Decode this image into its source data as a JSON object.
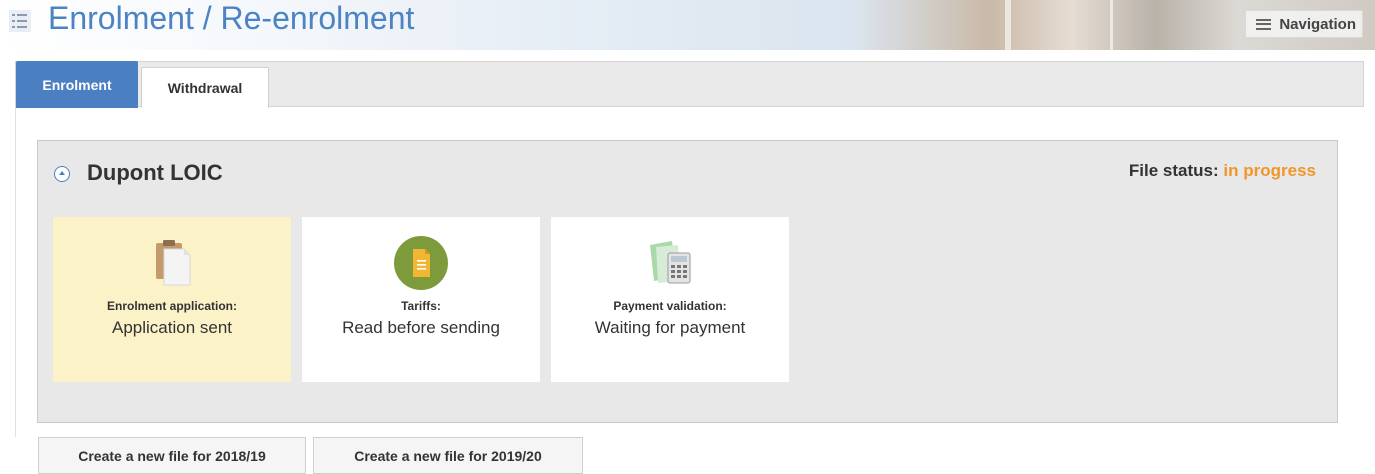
{
  "header": {
    "title": "Enrolment / Re-enrolment",
    "nav_label": "Navigation",
    "icon": "list-checklist-icon"
  },
  "tabs": [
    {
      "label": "Enrolment",
      "active": true
    },
    {
      "label": "Withdrawal",
      "active": false
    }
  ],
  "panel": {
    "person_name": "Dupont LOIC",
    "status_label": "File status:",
    "status_value": "in progress",
    "status_color": "#f0962a",
    "cards": [
      {
        "label": "Enrolment application:",
        "value": "Application sent",
        "icon": "clipboard-icon",
        "active": true
      },
      {
        "label": "Tariffs:",
        "value": "Read before sending",
        "icon": "document-circle-icon",
        "active": false
      },
      {
        "label": "Payment validation:",
        "value": "Waiting for payment",
        "icon": "calculator-icon",
        "active": false
      }
    ]
  },
  "actions": {
    "new_file_2018": "Create a new file for 2018/19",
    "new_file_2019": "Create a new file for 2019/20"
  },
  "colors": {
    "accent": "#4a7fc1",
    "title": "#4c84c3",
    "active_card": "#fcf2c8"
  }
}
